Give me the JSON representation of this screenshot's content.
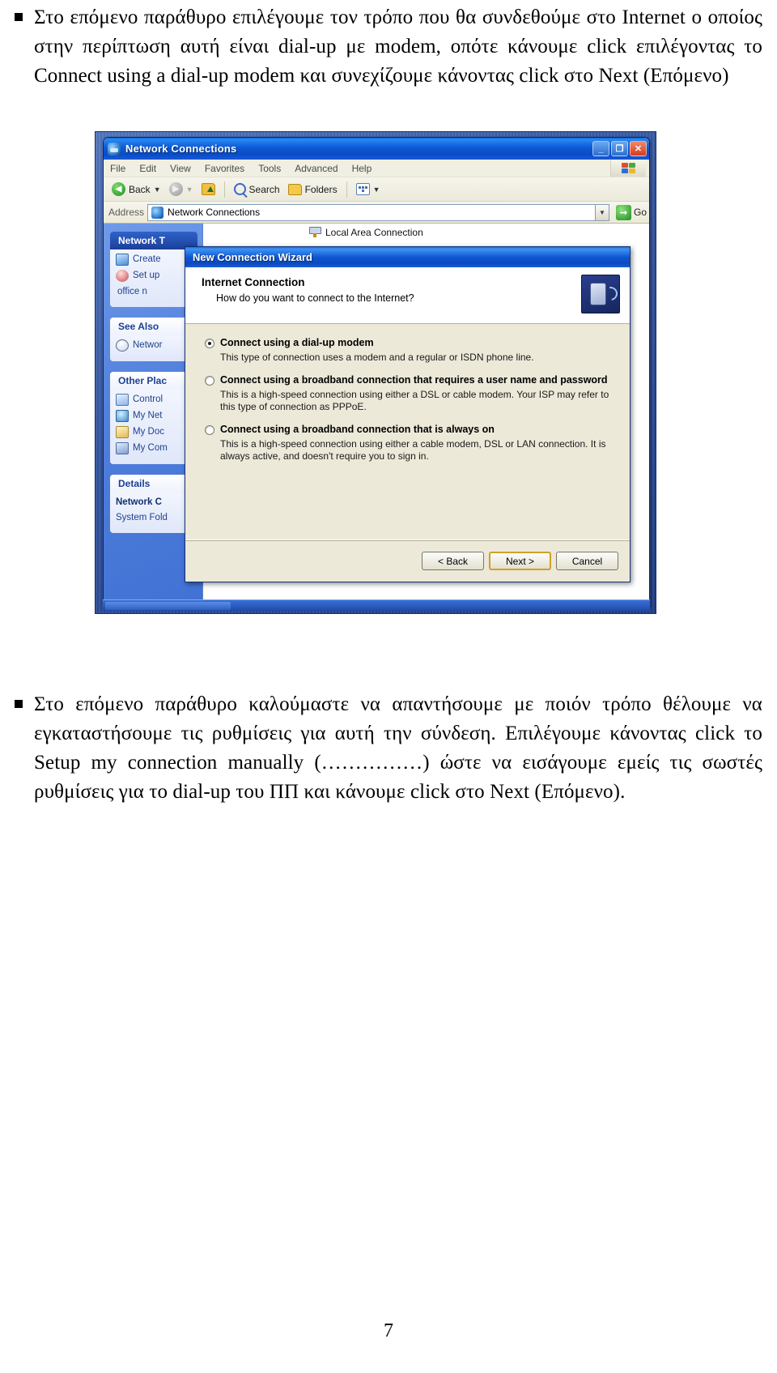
{
  "document": {
    "top_paragraph": "Στο επόμενο παράθυρο επιλέγουμε τον τρόπο που θα συνδεθούμε στο Internet ο οποίος στην περίπτωση αυτή είναι dial-up με modem, οπότε κάνουμε click επιλέγοντας το Connect using a dial-up modem και συνεχίζουμε κάνοντας click στο Next (Επόμενο)",
    "bottom_paragraph": "Στο επόμενο παράθυρο καλούμαστε να απαντήσουμε με ποιόν τρόπο θέλουμε να εγκαταστήσουμε τις ρυθμίσεις για αυτή την σύνδεση. Επιλέγουμε  κάνοντας click το Setup my connection manually (……………) ώστε να εισάγουμε εμείς τις σωστές ρυθμίσεις για το dial-up του ΠΠ και κάνουμε click στο Next (Επόμενο).",
    "page_number": "7"
  },
  "explorer": {
    "title": "Network Connections",
    "window_buttons": {
      "minimize": "_",
      "maximize": "❐",
      "close": "✕"
    },
    "menu": [
      "File",
      "Edit",
      "View",
      "Favorites",
      "Tools",
      "Advanced",
      "Help"
    ],
    "toolbar": {
      "back_label": "Back",
      "search_label": "Search",
      "folders_label": "Folders"
    },
    "address": {
      "label": "Address",
      "value": "Network Connections",
      "go_label": "Go"
    },
    "sidebar": {
      "panels": [
        {
          "heading": "Network T",
          "items": [
            "Create",
            "Set up",
            "office n"
          ]
        },
        {
          "heading": "See Also",
          "items": [
            "Networ"
          ]
        },
        {
          "heading": "Other Plac",
          "items": [
            "Control",
            "My Net",
            "My Doc",
            "My Com"
          ]
        },
        {
          "heading": "Details",
          "items": [
            "Network C",
            "System Fold"
          ]
        }
      ]
    },
    "content": {
      "items": [
        "Local Area Connection"
      ]
    }
  },
  "wizard": {
    "title": "New Connection Wizard",
    "header_title": "Internet Connection",
    "header_subtitle": "How do you want to connect to the Internet?",
    "options": [
      {
        "label": "Connect using a dial-up modem",
        "description": "This type of connection uses a modem and a regular or ISDN phone line.",
        "selected": true
      },
      {
        "label": "Connect using a broadband connection that requires a user name and password",
        "description": "This is a high-speed connection using either a DSL or cable modem. Your ISP may refer to this type of connection as PPPoE.",
        "selected": false
      },
      {
        "label": "Connect using a broadband connection that is always on",
        "description": "This is a high-speed connection using either a cable modem, DSL or LAN connection. It is always active, and doesn't require you to sign in.",
        "selected": false
      }
    ],
    "buttons": {
      "back": "< Back",
      "next": "Next >",
      "cancel": "Cancel"
    }
  },
  "colors": {
    "xp_blue": "#0b49bd",
    "desktop_blue": "#33549f",
    "dialog_face": "#ece9d8",
    "default_button_border": "#cfa02a"
  }
}
